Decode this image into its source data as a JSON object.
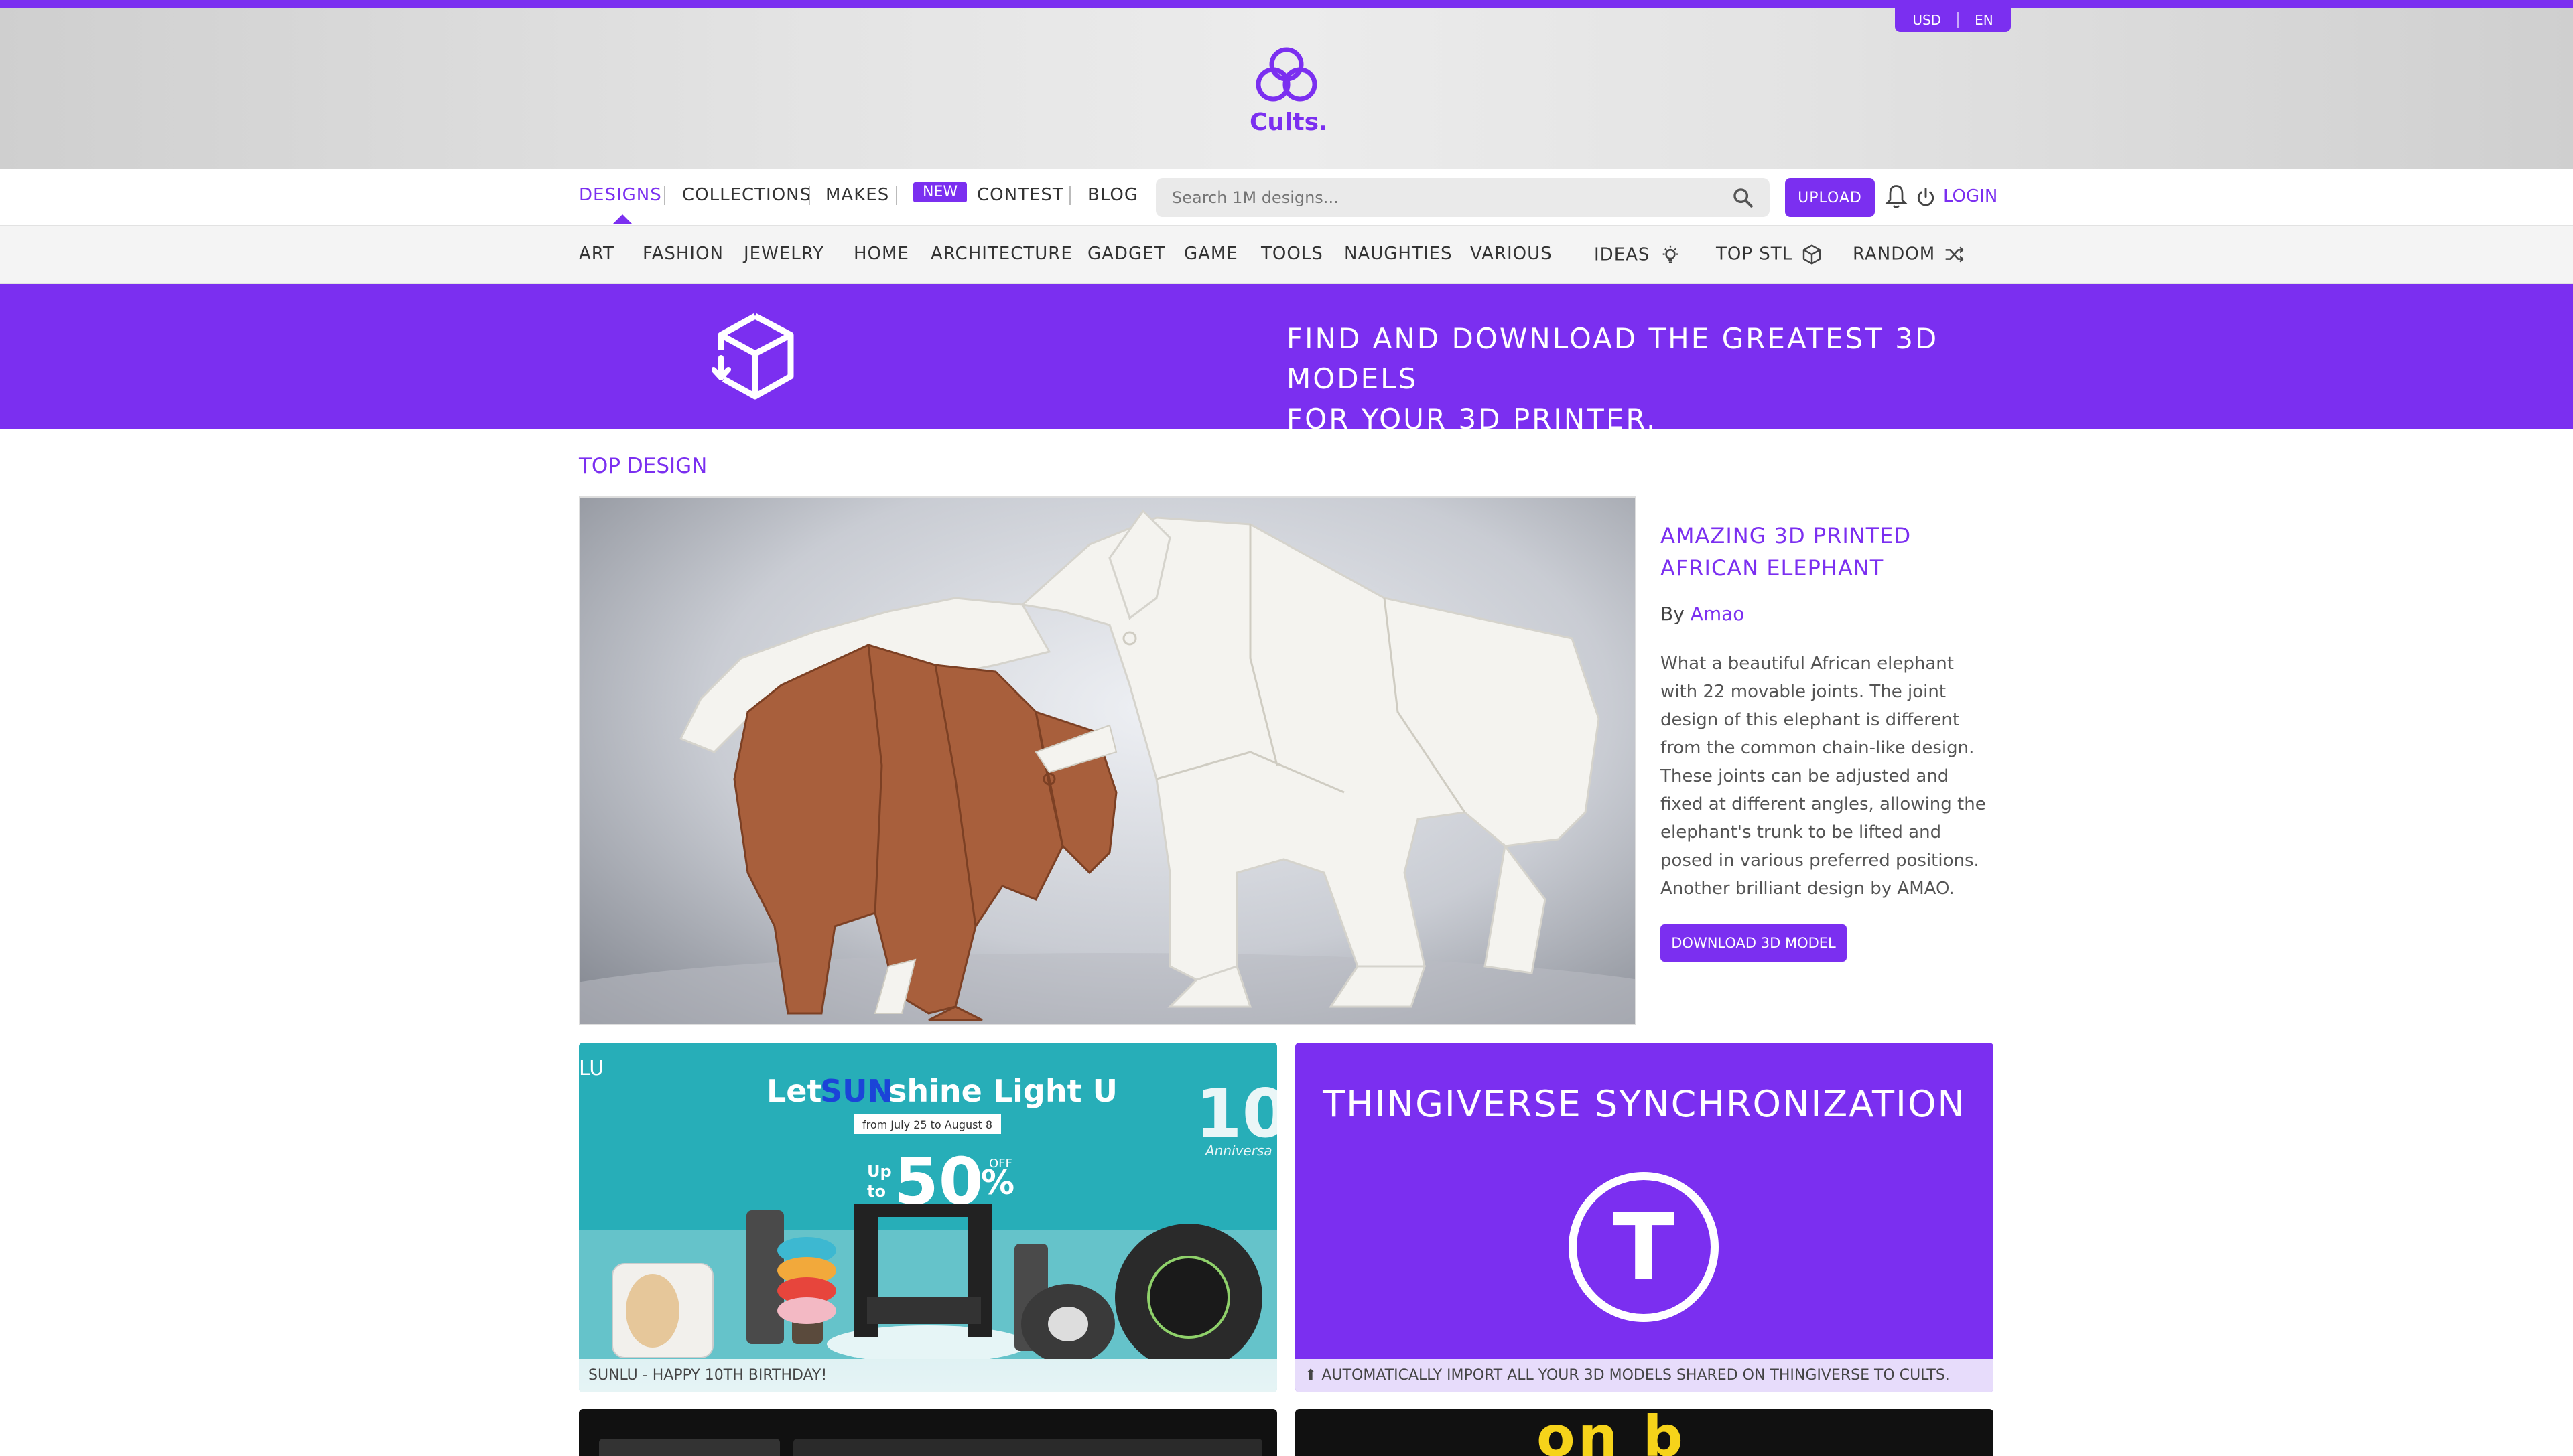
{
  "header": {
    "currency": "USD",
    "language": "EN",
    "logo_text": "Cults."
  },
  "nav_primary": {
    "items": [
      "DESIGNS",
      "COLLECTIONS",
      "MAKES",
      "CONTEST",
      "BLOG"
    ],
    "new_badge": "NEW",
    "search_placeholder": "Search 1M designs...",
    "upload_label": "UPLOAD",
    "login_label": "LOGIN"
  },
  "nav_categories": {
    "items": [
      "ART",
      "FASHION",
      "JEWELRY",
      "HOME",
      "ARCHITECTURE",
      "GADGET",
      "GAME",
      "TOOLS",
      "NAUGHTIES",
      "VARIOUS"
    ],
    "ideas": "IDEAS",
    "top_stl": "TOP STL",
    "random": "RANDOM"
  },
  "banner": {
    "text_line1": "FIND AND DOWNLOAD THE GREATEST 3D MODELS",
    "text_line2": "FOR YOUR 3D PRINTER."
  },
  "top_design": {
    "section_title": "TOP DESIGN",
    "title": "AMAZING 3D PRINTED AFRICAN ELEPHANT",
    "by_label": "By",
    "author": "Amao",
    "description": "What a beautiful African elephant with 22 movable joints. The joint design of this elephant is different from the common chain-like design. These joints can be adjusted and fixed at different angles, allowing the elephant's trunk to be lifted and posed in various preferred positions. Another brilliant design by AMAO.",
    "download_label": "DOWNLOAD 3D MODEL"
  },
  "promo_cards": {
    "left": {
      "headline_let": "Let",
      "headline_sun": "SUN",
      "headline_rest": "shine Light U",
      "dates": "from July 25 to August 8",
      "discount_up": "Up",
      "discount_to": "to",
      "discount": "50",
      "discount_off": "OFF",
      "tenth": "10",
      "anniversary": "Anniversa",
      "brand_corner": "LU",
      "caption": "SUNLU - HAPPY 10TH BIRTHDAY!"
    },
    "right": {
      "title": "THINGIVERSE SYNCHRONIZATION",
      "logo_letter": "T",
      "caption": "⬆ AUTOMATICALLY IMPORT ALL YOUR 3D MODELS SHARED ON THINGIVERSE TO CULTS."
    }
  },
  "bottom_partial": {
    "right_text": "on b"
  },
  "colors": {
    "brand": "#7b2ff0",
    "caption_bg": "#e7dcfb"
  }
}
